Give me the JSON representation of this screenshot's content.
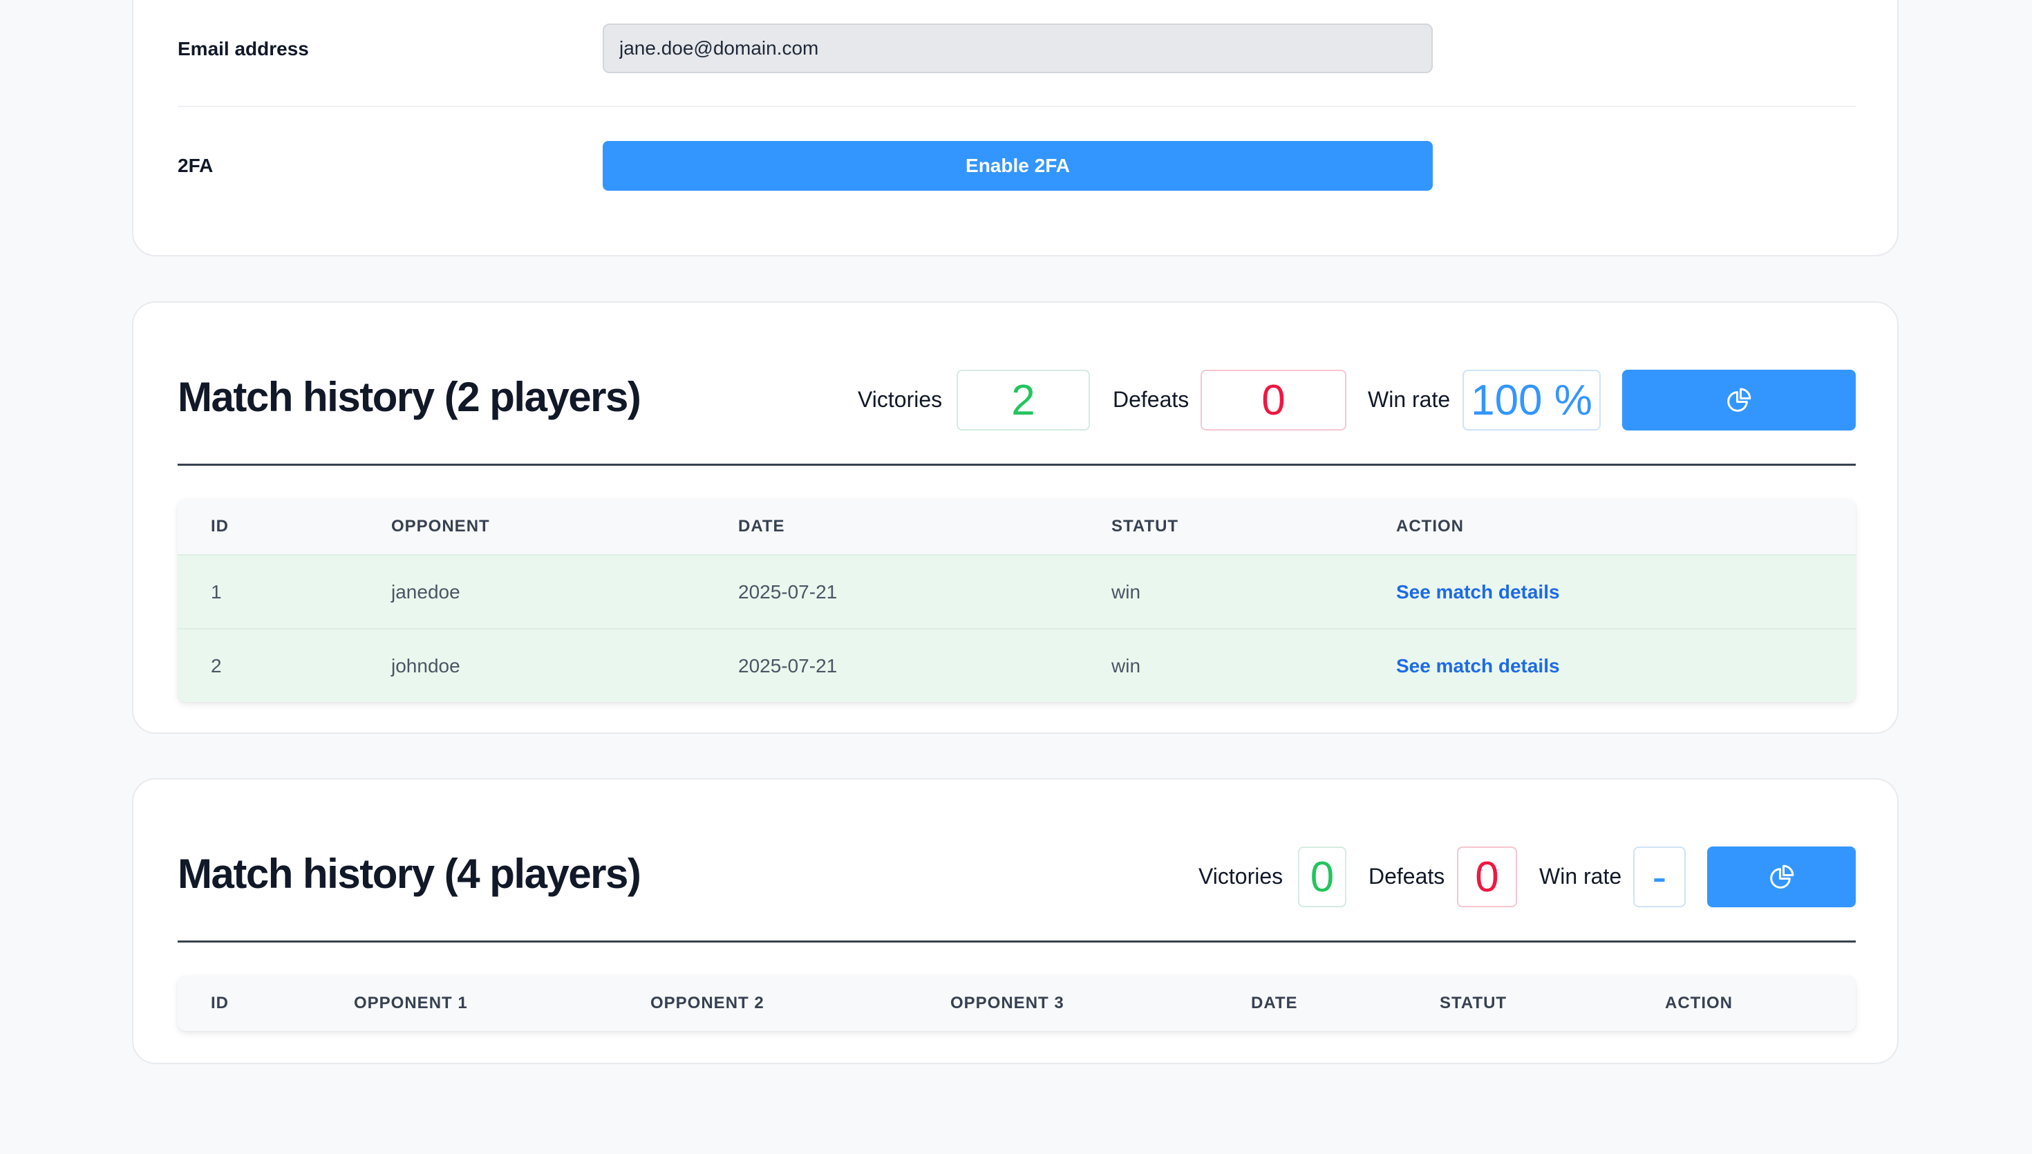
{
  "account": {
    "email_label": "Email address",
    "email_value": "jane.doe@domain.com",
    "twofa_label": "2FA",
    "twofa_button": "Enable 2FA"
  },
  "colors": {
    "primary": "#3396ff",
    "victory": "#22c55e",
    "defeat": "#f0173f",
    "row_win_bg": "#e9f7ee",
    "link": "#1e6ae6"
  },
  "history_2p": {
    "title": "Match history (2 players)",
    "victories_label": "Victories",
    "victories_value": "2",
    "defeats_label": "Defeats",
    "defeats_value": "0",
    "winrate_label": "Win rate",
    "winrate_value": "100 %",
    "stats_button_icon": "pie-chart-icon",
    "columns": [
      "ID",
      "OPPONENT",
      "DATE",
      "STATUT",
      "ACTION"
    ],
    "rows": [
      {
        "id": "1",
        "opponent": "janedoe",
        "date": "2025-07-21",
        "status": "win",
        "action": "See match details"
      },
      {
        "id": "2",
        "opponent": "johndoe",
        "date": "2025-07-21",
        "status": "win",
        "action": "See match details"
      }
    ]
  },
  "history_4p": {
    "title": "Match history (4 players)",
    "victories_label": "Victories",
    "victories_value": "0",
    "defeats_label": "Defeats",
    "defeats_value": "0",
    "winrate_label": "Win rate",
    "winrate_value": "-",
    "stats_button_icon": "pie-chart-icon",
    "columns": [
      "ID",
      "OPPONENT 1",
      "OPPONENT 2",
      "OPPONENT 3",
      "DATE",
      "STATUT",
      "ACTION"
    ],
    "rows": []
  }
}
